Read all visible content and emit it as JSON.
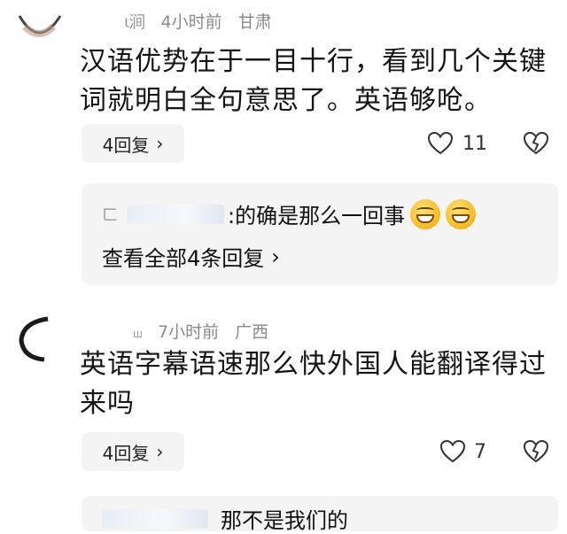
{
  "comment1": {
    "username": "ι涧",
    "time": "4小时前",
    "location": "甘肃",
    "text_line1": "汉语优势在于一目十行，看到几个关键",
    "text_line2": "词就明白全句意思了。英语够呛。",
    "reply_label": "4回复",
    "reply_chevron": "›",
    "like_count": "11",
    "sub_reply_text": ":的确是那么一回事",
    "sub_reply_prefix": "ㄈ",
    "view_all_label": "查看全部4条回复",
    "view_all_chevron": "›"
  },
  "comment2": {
    "username": "ш",
    "time": "7小时前",
    "location": "广西",
    "text_line1": "英语字幕语速那么快外国人能翻译得过",
    "text_line2": "来吗",
    "reply_label": "4回复",
    "reply_chevron": "›",
    "like_count": "7",
    "partial_next_text": "那不是我们的"
  },
  "icons": {
    "like": "heart-outline-icon",
    "dislike": "broken-heart-icon",
    "chevron": "chevron-right-icon"
  },
  "colors": {
    "meta_gray": "#8a8a8a",
    "pill_bg": "#f4f4f5",
    "text": "#151515"
  }
}
